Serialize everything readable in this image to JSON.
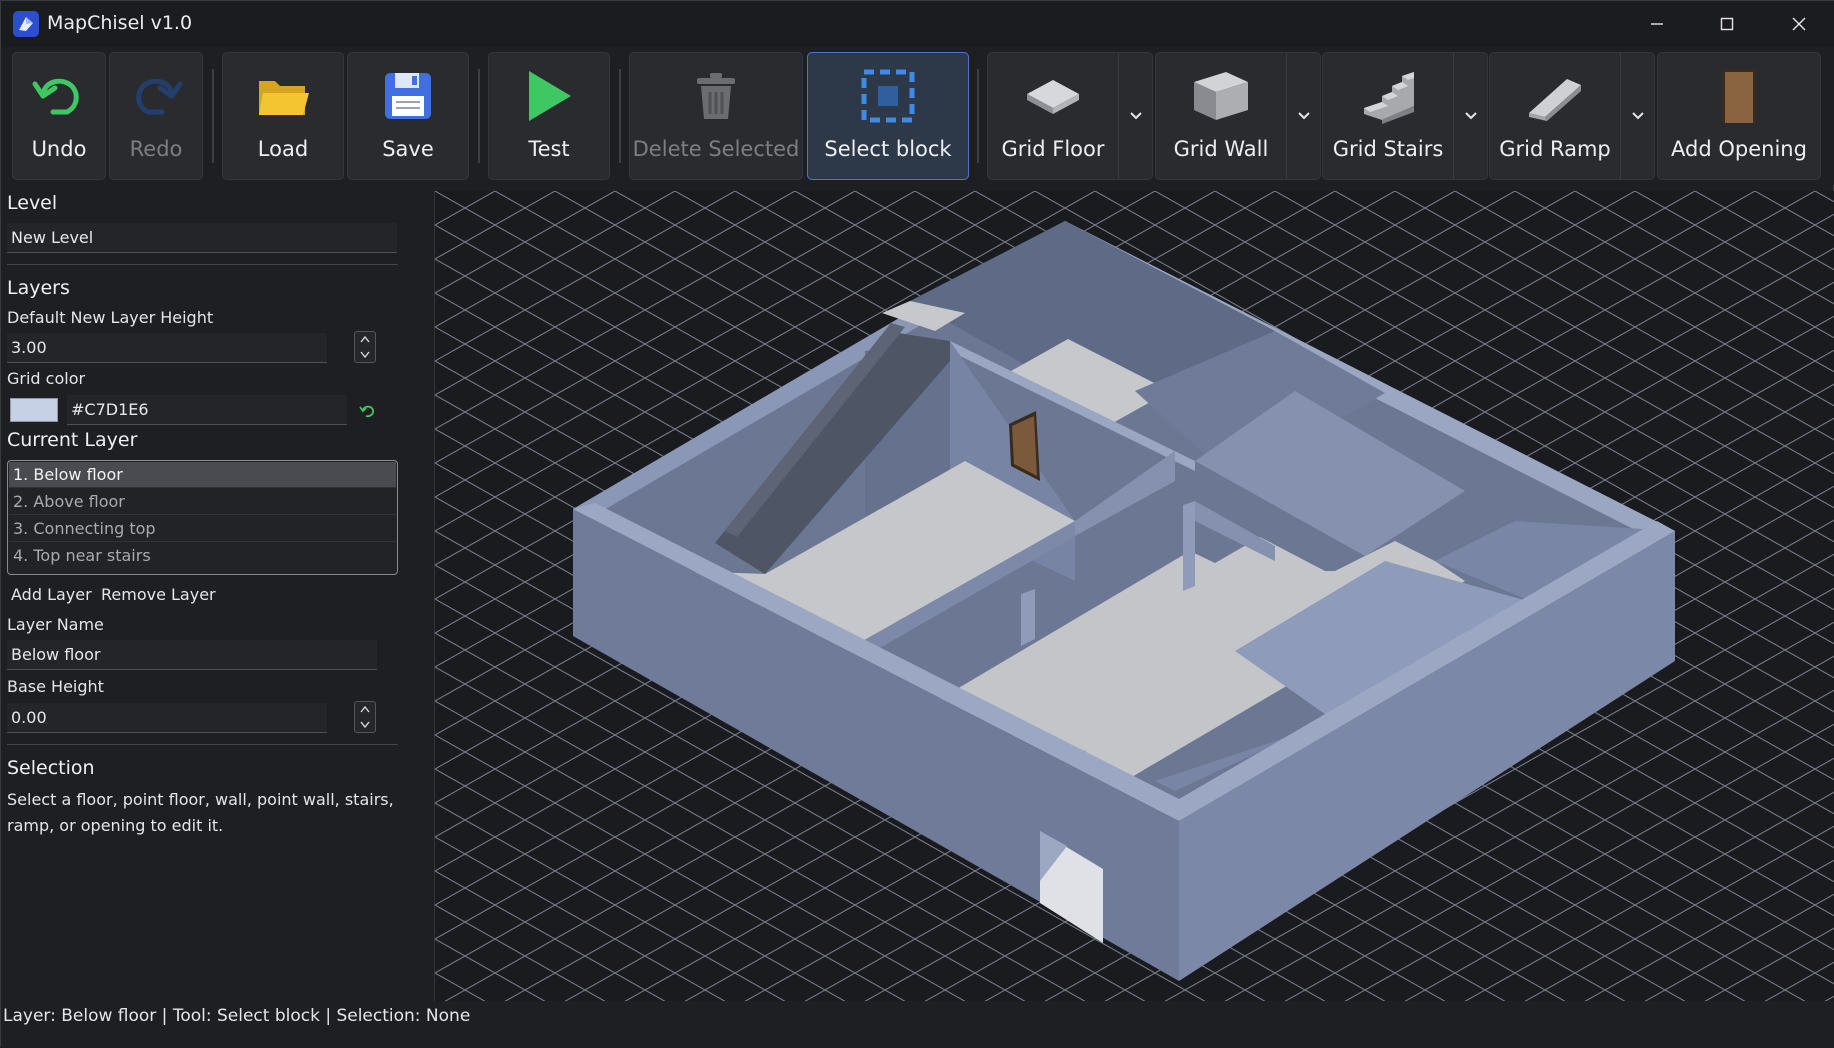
{
  "window": {
    "title": "MapChisel v1.0"
  },
  "toolbar": {
    "undo": "Undo",
    "redo": "Redo",
    "load": "Load",
    "save": "Save",
    "test": "Test",
    "delete_selected": "Delete Selected",
    "select_block": "Select block",
    "grid_floor": "Grid Floor",
    "grid_wall": "Grid Wall",
    "grid_stairs": "Grid Stairs",
    "grid_ramp": "Grid Ramp",
    "add_opening": "Add Opening"
  },
  "panel": {
    "level_title": "Level",
    "level_name": "New Level",
    "layers_title": "Layers",
    "default_height_label": "Default New Layer Height",
    "default_height_value": "3.00",
    "grid_color_label": "Grid color",
    "grid_color_value": "#C7D1E6",
    "current_layer_title": "Current Layer",
    "layers": [
      "1. Below floor",
      "2. Above floor",
      "3. Connecting top",
      "4. Top near stairs"
    ],
    "selected_layer_index": 0,
    "add_layer": "Add Layer",
    "remove_layer": "Remove Layer",
    "layer_name_label": "Layer Name",
    "layer_name_value": "Below floor",
    "base_height_label": "Base Height",
    "base_height_value": "0.00",
    "selection_title": "Selection",
    "selection_text": "Select a floor, point floor, wall, point wall, stairs, ramp, or opening to edit it."
  },
  "status": {
    "text": "Layer: Below floor | Tool: Select block | Selection: None"
  },
  "colors": {
    "accent": "#4a78c8",
    "grid_lines": "#C7D1E6",
    "wall": "#7d89a8",
    "floor": "#c8c9cd",
    "door": "#7b5a3c"
  }
}
